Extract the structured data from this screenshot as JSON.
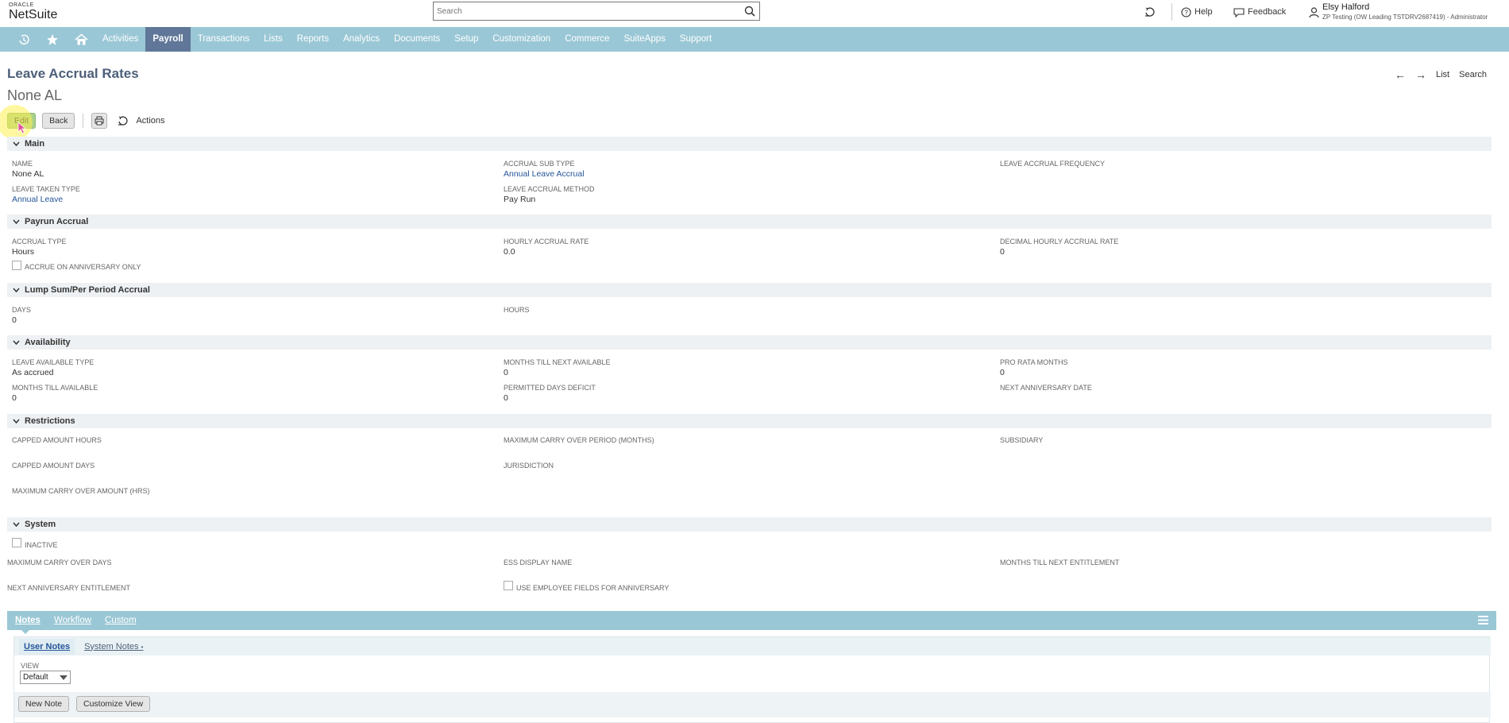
{
  "header": {
    "logo_top": "ORACLE",
    "logo_main": "NetSuite",
    "search_placeholder": "Search",
    "help_label": "Help",
    "feedback_label": "Feedback",
    "user_name": "Elsy Halford",
    "user_role": "ZP Testing (OW Leading TSTDRV2687419) - Administrator"
  },
  "nav": {
    "items": [
      "Activities",
      "Payroll",
      "Transactions",
      "Lists",
      "Reports",
      "Analytics",
      "Documents",
      "Setup",
      "Customization",
      "Commerce",
      "SuiteApps",
      "Support"
    ],
    "active": "Payroll"
  },
  "page": {
    "type_title": "Leave Accrual Rates",
    "record_name": "None AL",
    "nav_prev": "←",
    "nav_next": "→",
    "list_label": "List",
    "search_label": "Search"
  },
  "buttons": {
    "edit": "Edit",
    "back": "Back",
    "actions": "Actions"
  },
  "sections": {
    "main": {
      "title": "Main",
      "name_label": "NAME",
      "name_value": "None AL",
      "leave_taken_type_label": "LEAVE TAKEN TYPE",
      "leave_taken_type_value": "Annual Leave",
      "accrual_sub_type_label": "ACCRUAL SUB TYPE",
      "accrual_sub_type_value": "Annual Leave Accrual",
      "leave_accrual_method_label": "LEAVE ACCRUAL METHOD",
      "leave_accrual_method_value": "Pay Run",
      "leave_accrual_frequency_label": "LEAVE ACCRUAL FREQUENCY"
    },
    "payrun": {
      "title": "Payrun Accrual",
      "accrual_type_label": "ACCRUAL TYPE",
      "accrual_type_value": "Hours",
      "accrue_anniversary_label": "ACCRUE ON ANNIVERSARY ONLY",
      "hourly_rate_label": "HOURLY ACCRUAL RATE",
      "hourly_rate_value": "0.0",
      "decimal_rate_label": "DECIMAL HOURLY ACCRUAL RATE",
      "decimal_rate_value": "0"
    },
    "lumpsum": {
      "title": "Lump Sum/Per Period Accrual",
      "days_label": "DAYS",
      "days_value": "0",
      "hours_label": "HOURS"
    },
    "availability": {
      "title": "Availability",
      "leave_available_type_label": "LEAVE AVAILABLE TYPE",
      "leave_available_type_value": "As accrued",
      "months_till_available_label": "MONTHS TILL AVAILABLE",
      "months_till_available_value": "0",
      "months_till_next_label": "MONTHS TILL NEXT AVAILABLE",
      "months_till_next_value": "0",
      "permitted_deficit_label": "PERMITTED DAYS DEFICIT",
      "permitted_deficit_value": "0",
      "pro_rata_label": "PRO RATA MONTHS",
      "pro_rata_value": "0",
      "next_anniversary_date_label": "NEXT ANNIVERSARY DATE"
    },
    "restrictions": {
      "title": "Restrictions",
      "capped_hours_label": "CAPPED AMOUNT HOURS",
      "capped_days_label": "CAPPED AMOUNT DAYS",
      "max_carry_hrs_label": "MAXIMUM CARRY OVER AMOUNT (HRS)",
      "max_carry_period_label": "MAXIMUM CARRY OVER PERIOD (MONTHS)",
      "jurisdiction_label": "JURISDICTION",
      "subsidiary_label": "SUBSIDIARY"
    },
    "system": {
      "title": "System",
      "inactive_label": "INACTIVE",
      "max_carry_days_label": "MAXIMUM CARRY OVER DAYS",
      "next_anniversary_entitlement_label": "NEXT ANNIVERSARY ENTITLEMENT",
      "ess_display_name_label": "ESS DISPLAY NAME",
      "use_employee_fields_label": "USE EMPLOYEE FIELDS FOR ANNIVERSARY",
      "months_till_next_entitlement_label": "MONTHS TILL NEXT ENTITLEMENT"
    }
  },
  "subtabs": {
    "items": [
      "Notes",
      "Workflow",
      "Custom"
    ],
    "active": "Notes",
    "inner": [
      "User Notes",
      "System Notes"
    ],
    "inner_suffix": "•",
    "view_label": "VIEW",
    "view_value": "Default",
    "new_note": "New Note",
    "customize_view": "Customize View"
  },
  "colors": {
    "nav_bg": "#9ac7d5",
    "nav_active": "#607799",
    "title": "#4d5f79",
    "link": "#255599",
    "edit_button": "#a8d08d",
    "highlight": "#fff050"
  },
  "icons": [
    "search-icon",
    "recent-icon",
    "star-icon",
    "home-icon",
    "help-icon",
    "feedback-icon",
    "user-icon",
    "print-icon",
    "actions-icon",
    "chevron-down-icon",
    "list-toggle-icon",
    "cursor-icon"
  ]
}
